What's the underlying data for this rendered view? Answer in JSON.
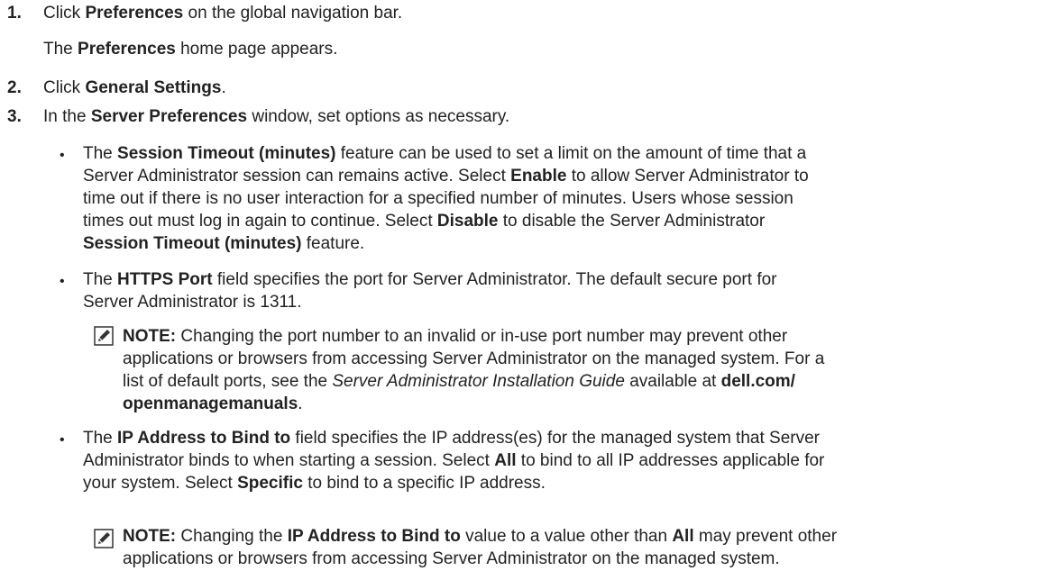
{
  "bullet_char": "•",
  "steps": [
    {
      "number": "1.",
      "pre": "Click ",
      "bold": "Preferences",
      "post": " on the global navigation bar.",
      "result_pre": "The ",
      "result_bold": "Preferences",
      "result_post": " home page appears."
    },
    {
      "number": "2.",
      "pre": "Click ",
      "bold": "General Settings",
      "post": "."
    },
    {
      "number": "3.",
      "pre": "In the ",
      "bold": "Server Preferences",
      "post": " window, set options as necessary."
    }
  ],
  "bullets": [
    {
      "l1a": "The ",
      "l1b": "Session Timeout (minutes)",
      "l1c": " feature can be used to set a limit on the amount of time that a",
      "l2a": "Server Administrator session can remains active. Select ",
      "l2b": "Enable",
      "l2c": " to allow Server Administrator to",
      "l3": "time out if there is no user interaction for a specified number of minutes. Users whose session",
      "l4a": "times out must log in again to continue. Select ",
      "l4b": "Disable",
      "l4c": " to disable the Server Administrator",
      "l5a": "Session Timeout (minutes)",
      "l5b": " feature."
    },
    {
      "l1a": "The ",
      "l1b": "HTTPS Port",
      "l1c": " field specifies the port for Server Administrator. The default secure port for",
      "l2": "Server Administrator is 1311."
    },
    {
      "l1a": "The ",
      "l1b": "IP Address to Bind to",
      "l1c": " field specifies the IP address(es) for the managed system that Server",
      "l2a": "Administrator binds to when starting a session. Select ",
      "l2b": "All",
      "l2c": " to bind to all IP addresses applicable for",
      "l3a": "your system. Select ",
      "l3b": "Specific",
      "l3c": " to bind to a specific IP address."
    }
  ],
  "notes": [
    {
      "label": "NOTE:",
      "l1": " Changing the port number to an invalid or in-use port number may prevent other",
      "l2": "applications or browsers from accessing Server Administrator on the managed system. For a",
      "l3a": "list of default ports, see the ",
      "l3b": "Server Administrator Installation Guide",
      "l3c": " available at ",
      "l3d": "dell.com/",
      "l4a": "openmanagemanuals",
      "l4b": "."
    },
    {
      "label": "NOTE:",
      "l1a": " Changing the ",
      "l1b": "IP Address to Bind to",
      "l1c": " value to a value other than ",
      "l1d": "All",
      "l1e": " may prevent other",
      "l2": "applications or browsers from accessing Server Administrator on the managed system."
    }
  ]
}
